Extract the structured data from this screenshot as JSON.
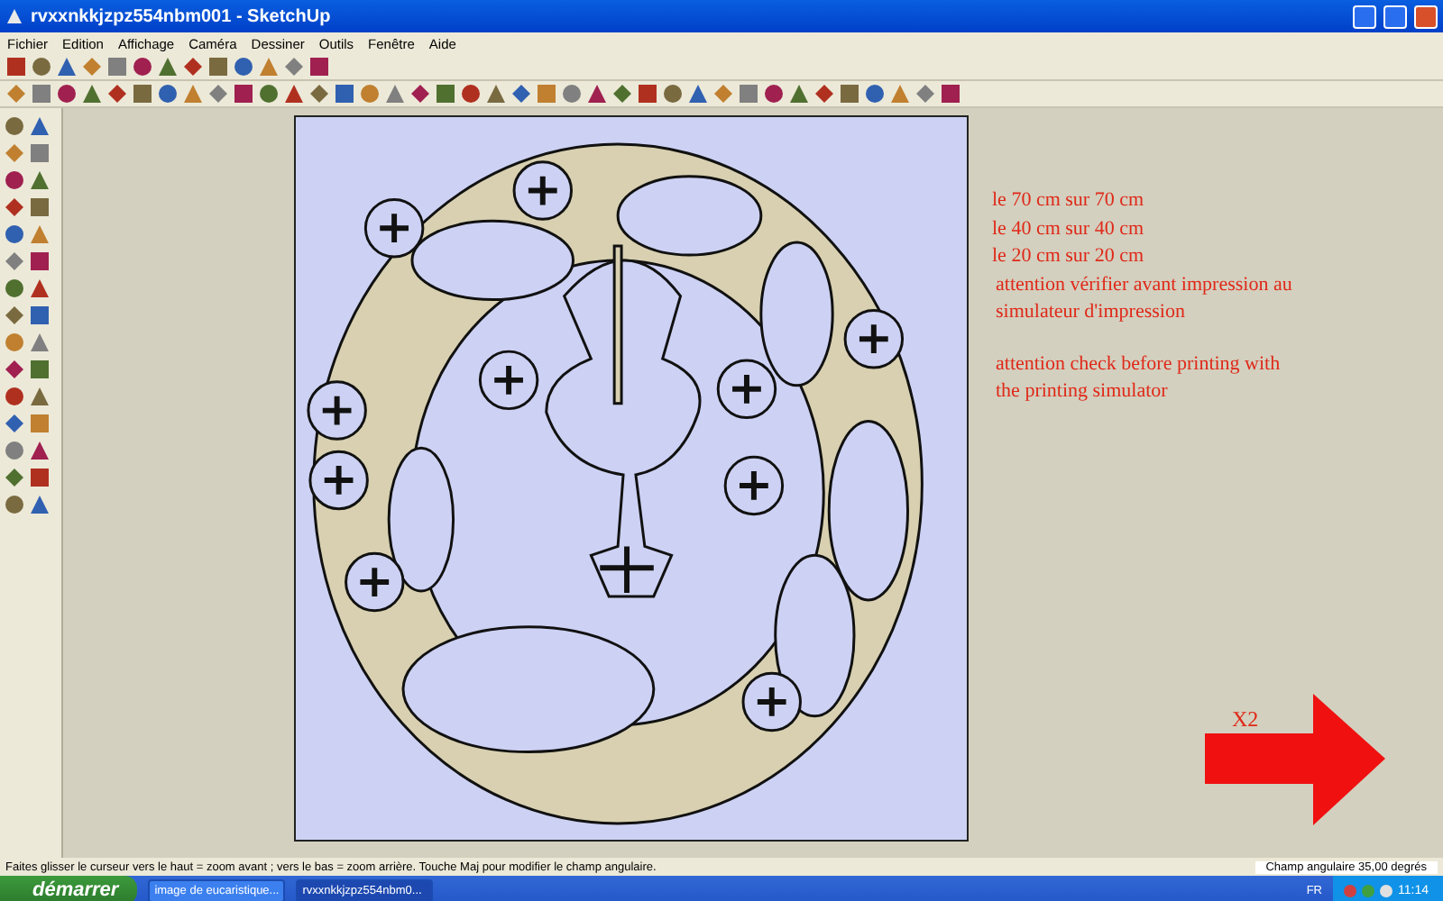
{
  "window": {
    "title": "rvxxnkkjzpz554nbm001 - SketchUp"
  },
  "menu": [
    "Fichier",
    "Edition",
    "Affichage",
    "Caméra",
    "Dessiner",
    "Outils",
    "Fenêtre",
    "Aide"
  ],
  "canvas": {
    "notes": [
      {
        "text": "le 70 cm sur 70 cm",
        "kind": "size"
      },
      {
        "text": "le 40 cm sur 40 cm",
        "kind": "size"
      },
      {
        "text": "le 20 cm sur 20 cm",
        "kind": "size"
      },
      {
        "text": "attention vérifier avant impression au",
        "kind": "warning"
      },
      {
        "text": "simulateur d'impression",
        "kind": "warning"
      },
      {
        "text": "attention check before printing with",
        "kind": "gap"
      },
      {
        "text": "the printing simulator",
        "kind": "warning"
      }
    ],
    "multiplier_label": "X2"
  },
  "status_bar": {
    "hint": "Faites glisser le curseur vers le haut = zoom avant ; vers le bas = zoom arrière. Touche Maj pour modifier le champ angulaire.",
    "value": "Champ angulaire 35,00 degrés"
  },
  "taskbar": {
    "start": "démarrer",
    "tasks": [
      {
        "label": "image de eucaristique...",
        "selected": false
      },
      {
        "label": "rvxxnkkjzpz554nbm0...",
        "selected": true
      }
    ],
    "language": "FR",
    "clock": "11:14"
  }
}
